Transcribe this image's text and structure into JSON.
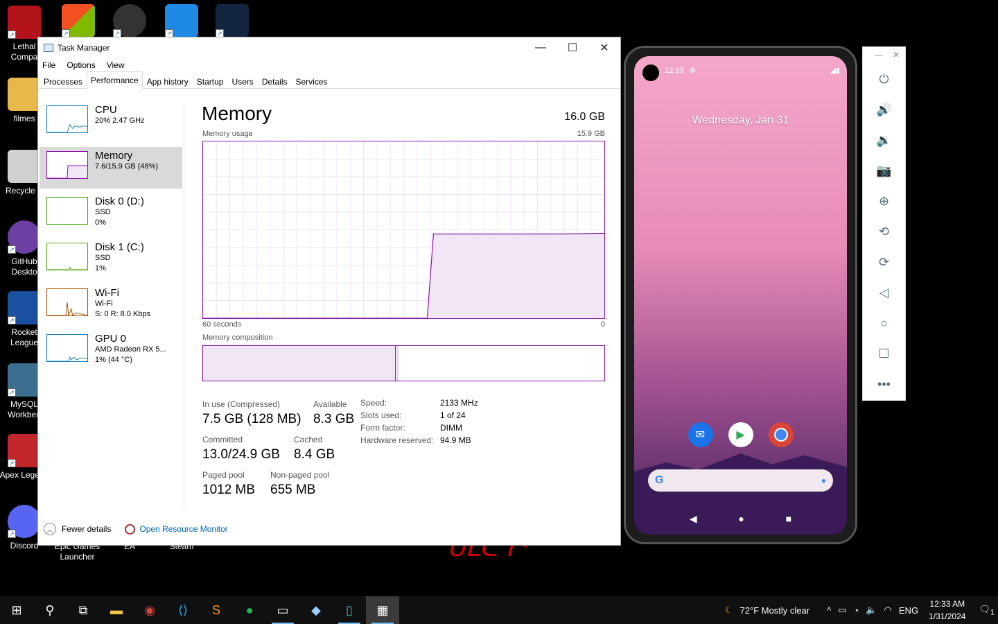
{
  "desktop": {
    "icons": [
      {
        "label": "Lethal Compa",
        "color": "#b3141b"
      },
      {
        "label": "filmes",
        "color": "#e9b84a"
      },
      {
        "label": "Recycle B",
        "color": "#d0d0d0"
      },
      {
        "label": "GitHub Deskto",
        "color": "#6e3fa3"
      },
      {
        "label": "Rocket League",
        "color": "#1b4fa0"
      },
      {
        "label": "MySQL Workben",
        "color": "#3c6e8f"
      },
      {
        "label": "Apex Legend",
        "color": "#c0262c"
      },
      {
        "label": "Discord",
        "color": "#5865f2"
      }
    ],
    "bottom_labels": [
      "Epic Games Launcher",
      "EA",
      "Steam"
    ],
    "bg_text": "ᑌᒪᑕᒉᑉ"
  },
  "task_manager": {
    "title": "Task Manager",
    "menu": [
      "File",
      "Options",
      "View"
    ],
    "tabs": [
      "Processes",
      "Performance",
      "App history",
      "Startup",
      "Users",
      "Details",
      "Services"
    ],
    "active_tab": "Performance",
    "sidebar": [
      {
        "name": "CPU",
        "sub1": "20% 2.47 GHz",
        "sub2": "",
        "sub3": "",
        "color": "#117dbb"
      },
      {
        "name": "Memory",
        "sub1": "7.6/15.9 GB (48%)",
        "sub2": "",
        "sub3": "",
        "color": "#8b12ae"
      },
      {
        "name": "Disk 0 (D:)",
        "sub1": "SSD",
        "sub2": "0%",
        "sub3": "",
        "color": "#4da60c"
      },
      {
        "name": "Disk 1 (C:)",
        "sub1": "SSD",
        "sub2": "1%",
        "sub3": "",
        "color": "#4da60c"
      },
      {
        "name": "Wi-Fi",
        "sub1": "Wi-Fi",
        "sub2": "S: 0 R: 8.0 Kbps",
        "sub3": "",
        "color": "#a74f01"
      },
      {
        "name": "GPU 0",
        "sub1": "AMD Radeon RX 5...",
        "sub2": "1% (44 °C)",
        "sub3": "",
        "color": "#117dbb"
      }
    ],
    "memory": {
      "title": "Memory",
      "total": "16.0 GB",
      "usage_label": "Memory usage",
      "usage_max": "15.9 GB",
      "time_label": "60 seconds",
      "time_end": "0",
      "composition_label": "Memory composition",
      "in_use_fraction": 0.48,
      "stats": {
        "in_use_label": "In use (Compressed)",
        "in_use_value": "7.5 GB (128 MB)",
        "available_label": "Available",
        "available_value": "8.3 GB",
        "committed_label": "Committed",
        "committed_value": "13.0/24.9 GB",
        "cached_label": "Cached",
        "cached_value": "8.4 GB",
        "paged_label": "Paged pool",
        "paged_value": "1012 MB",
        "nonpaged_label": "Non-paged pool",
        "nonpaged_value": "655 MB"
      },
      "specs": [
        {
          "k": "Speed:",
          "v": "2133 MHz"
        },
        {
          "k": "Slots used:",
          "v": "1 of 24"
        },
        {
          "k": "Form factor:",
          "v": "DIMM"
        },
        {
          "k": "Hardware reserved:",
          "v": "94.9 MB"
        }
      ]
    },
    "footer": {
      "fewer": "Fewer details",
      "resmon": "Open Resource Monitor"
    }
  },
  "phone": {
    "time": "12:33",
    "date": "Wednesday, Jan 31"
  },
  "taskbar": {
    "weather": "72°F  Mostly clear",
    "lang": "ENG",
    "time": "12:33 AM",
    "date": "1/31/2024",
    "notif_count": "1"
  }
}
